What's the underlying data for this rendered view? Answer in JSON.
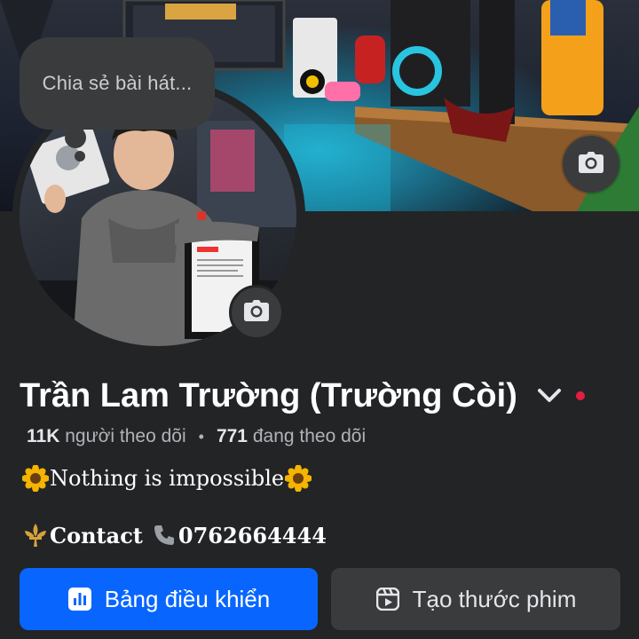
{
  "note": {
    "placeholder": "Chia sẻ bài hát..."
  },
  "profile": {
    "name": "Trần Lam Trường (Trường Còi)",
    "followers_count": "11K",
    "followers_label": "người theo dõi",
    "following_count": "771",
    "following_label": "đang theo dõi",
    "separator": "•",
    "bio_text": "Nothing is impossible",
    "contact_label": "Contact",
    "contact_phone": "0762664444"
  },
  "buttons": {
    "dashboard_label": "Bảng điều khiển",
    "create_reel_label": "Tạo thước phim"
  },
  "icons": {
    "cover_camera": "camera-icon",
    "avatar_camera": "camera-icon",
    "name_menu": "chevron-down-icon",
    "status": "red-dot",
    "bio_emoji": "sunflower-icon",
    "contact_emoji": "fleur-de-lis-icon",
    "phone_emoji": "phone-icon",
    "dashboard": "bar-chart-icon",
    "reel": "reel-icon"
  },
  "colors": {
    "background": "#232426",
    "primary_button": "#0866ff",
    "secondary_button": "#3a3b3c",
    "status_dot": "#e41e3f"
  }
}
